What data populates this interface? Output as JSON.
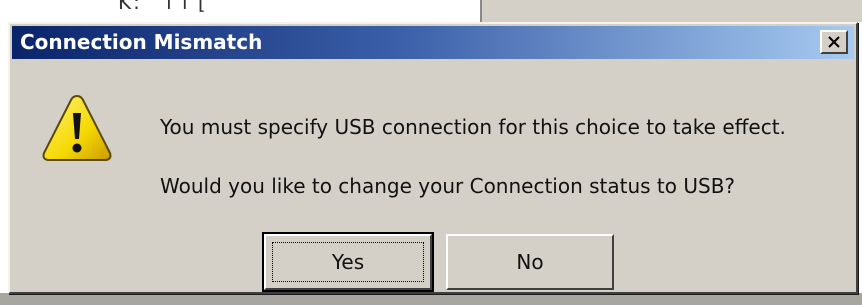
{
  "background": {
    "partial_text": "K: ' l l ["
  },
  "dialog": {
    "title": "Connection Mismatch",
    "close_icon": "close-icon",
    "warning_icon": "warning-icon",
    "message_line_1": "You must specify USB connection for this choice to take effect.",
    "message_line_2": "Would you like to change your Connection status to USB?",
    "buttons": {
      "yes_label": "Yes",
      "no_label": "No"
    },
    "default_button": "Yes"
  },
  "colors": {
    "titlebar_start": "#0a246a",
    "titlebar_end": "#a6caf0",
    "dialog_face": "#d4d0c8",
    "warning_yellow": "#f5d800"
  }
}
